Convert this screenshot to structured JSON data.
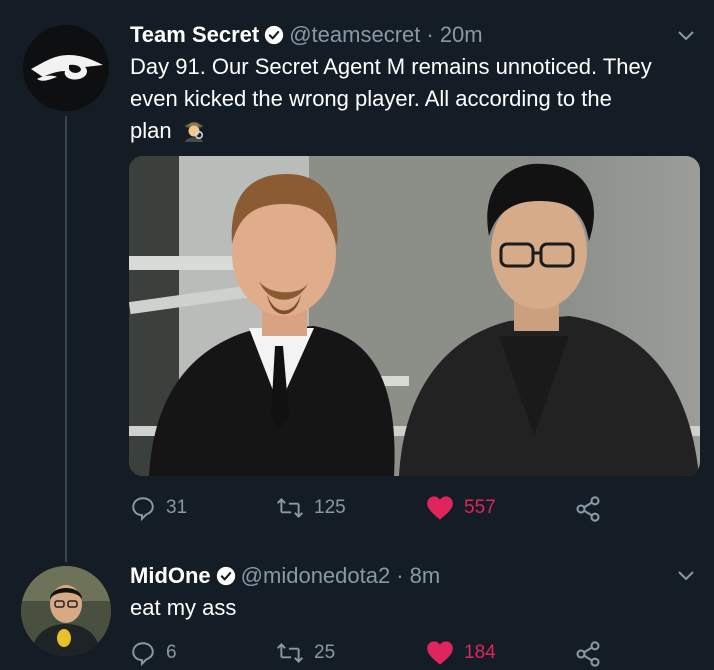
{
  "tweet1": {
    "name": "Team Secret",
    "handle": "@teamsecret",
    "time": "· 20m",
    "lines": [
      "Day 91. Our Secret Agent M remains unnoticed. They",
      "even kicked the wrong player. All according to the",
      "plan"
    ],
    "emoji_icon": "detective-icon",
    "replies": "31",
    "retweets": "125",
    "likes": "557"
  },
  "tweet2": {
    "name": "MidOne",
    "handle": "@midonedota2",
    "time": "· 8m",
    "text": "eat my ass",
    "replies": "6",
    "retweets": "25",
    "likes": "184"
  },
  "colors": {
    "background": "#141d26",
    "secondary_text": "#8899a6",
    "like": "#e0245e",
    "verified_badge": "#ffffff"
  }
}
